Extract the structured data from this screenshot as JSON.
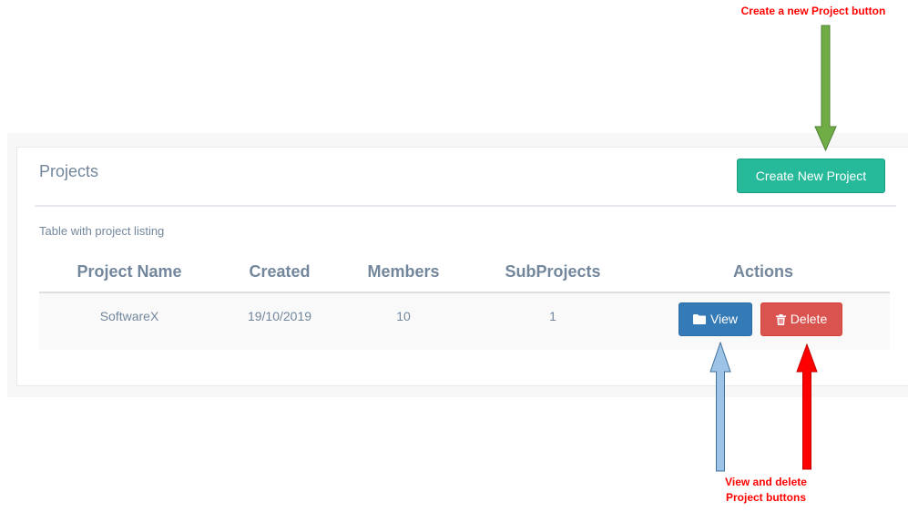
{
  "panel": {
    "title": "Projects",
    "create_button_label": "Create New Project"
  },
  "table": {
    "caption": "Table with project listing",
    "headers": [
      "Project Name",
      "Created",
      "Members",
      "SubProjects",
      "Actions"
    ],
    "rows": [
      {
        "project_name": "SoftwareX",
        "created": "19/10/2019",
        "members": "10",
        "subprojects": "1",
        "view_label": "View",
        "delete_label": "Delete"
      }
    ]
  },
  "annotations": {
    "create_note": "Create a new Project button",
    "actions_note_line1": "View and delete",
    "actions_note_line2": "Project buttons"
  },
  "icons": {
    "view": "folder-icon",
    "delete": "trash-icon"
  },
  "colors": {
    "create_button": "#26b99a",
    "view_button": "#337ab7",
    "delete_button": "#d9534f",
    "annotation_text": "#ff0000",
    "arrow_green": "#70ad47",
    "arrow_blue": "#9dc3e6",
    "arrow_red": "#ff0000"
  }
}
